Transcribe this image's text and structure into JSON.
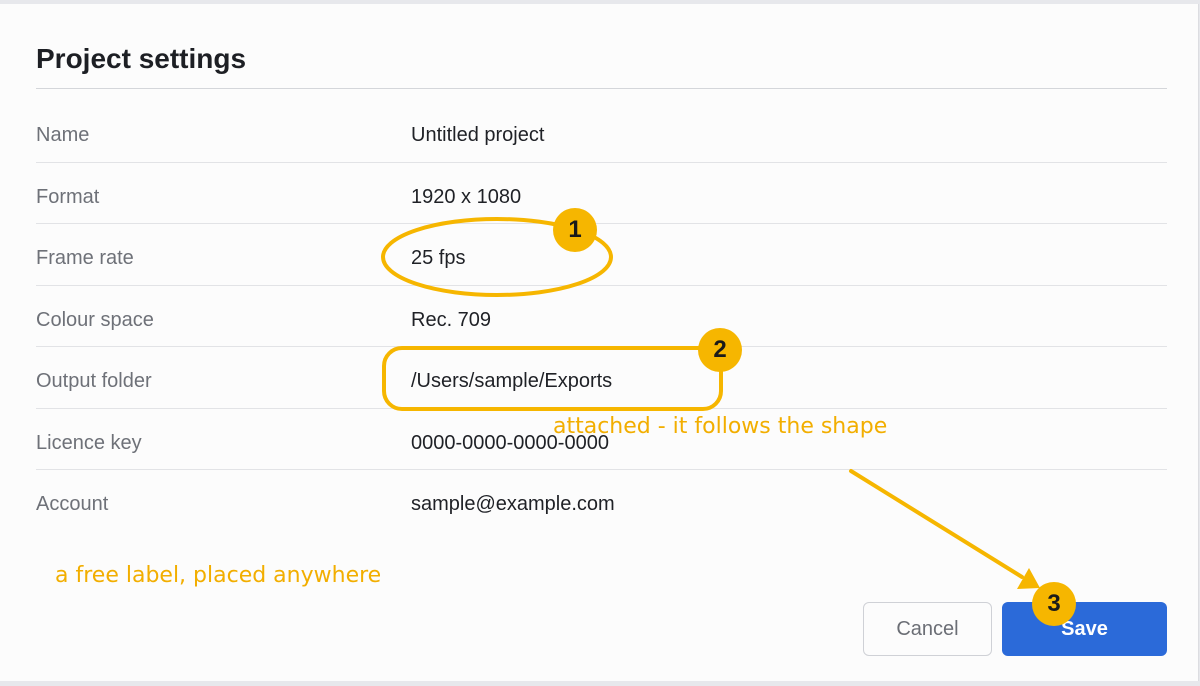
{
  "dialog": {
    "title": "Project settings",
    "rows": [
      {
        "label": "Name",
        "value": "Untitled project"
      },
      {
        "label": "Format",
        "value": "1920 x 1080"
      },
      {
        "label": "Frame rate",
        "value": "25 fps"
      },
      {
        "label": "Colour space",
        "value": "Rec. 709"
      },
      {
        "label": "Output folder",
        "value": "/Users/sample/Exports"
      },
      {
        "label": "Licence key",
        "value": "0000-0000-0000-0000"
      },
      {
        "label": "Account",
        "value": "sample@example.com"
      }
    ],
    "cancel_label": "Cancel",
    "save_label": "Save"
  },
  "annotations": {
    "color": "#f6b600",
    "badges": [
      "1",
      "2",
      "3"
    ],
    "attached_note": "attached - it follows the shape",
    "free_note": "a free label, placed anywhere"
  },
  "colors": {
    "primary": "#2b6ad9",
    "annotation": "#f6b600"
  }
}
